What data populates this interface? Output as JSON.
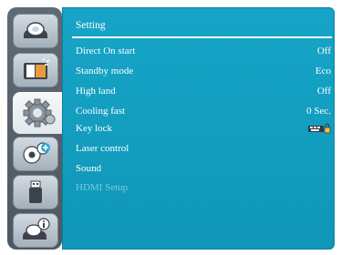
{
  "sidebar": {
    "items": [
      {
        "icon": "picture-icon"
      },
      {
        "icon": "screen-icon"
      },
      {
        "icon": "setting-gear-icon",
        "active": true
      },
      {
        "icon": "expand-gear-icon"
      },
      {
        "icon": "usb-icon"
      },
      {
        "icon": "info-icon"
      }
    ]
  },
  "panel": {
    "title": "Setting",
    "rows": [
      {
        "label": "Direct On start",
        "value": "Off"
      },
      {
        "label": "Standby mode",
        "value": "Eco"
      },
      {
        "label": "High land",
        "value": "Off"
      },
      {
        "label": "Cooling fast",
        "value": "0 Sec."
      },
      {
        "label": "Key lock",
        "value": "",
        "value_icon": "keylock-icon"
      },
      {
        "label": "Laser control",
        "value": ""
      },
      {
        "label": "Sound",
        "value": ""
      },
      {
        "label": "HDMI Setup",
        "value": "",
        "disabled": true
      }
    ]
  },
  "colors": {
    "panel_bg": "#13a0c2",
    "sidebar_bg": "#55616b",
    "text": "#ffffff",
    "disabled_text": "#7bc8dc"
  }
}
